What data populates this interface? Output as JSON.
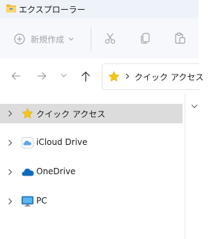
{
  "window": {
    "title": "エクスプローラー",
    "title_icon": "folder-icon"
  },
  "ribbon": {
    "new_label": "新規作成",
    "new_icon": "plus-circle-icon",
    "actions": [
      "cut-icon",
      "copy-icon",
      "paste-icon"
    ]
  },
  "nav": {
    "buttons": [
      "back-arrow-icon",
      "forward-arrow-icon",
      "recent-dropdown-icon",
      "up-arrow-icon"
    ],
    "address": {
      "icon": "star-icon",
      "path": "クイック アクセス"
    }
  },
  "tree": {
    "items": [
      {
        "label": "クイック アクセス",
        "icon": "star-icon",
        "selected": true
      },
      {
        "label": "iCloud Drive",
        "icon": "icloud-icon",
        "selected": false
      },
      {
        "label": "OneDrive",
        "icon": "onedrive-cloud-icon",
        "selected": false
      },
      {
        "label": "PC",
        "icon": "monitor-icon",
        "selected": false
      }
    ]
  },
  "colors": {
    "star": "#f5c518",
    "onedrive": "#0f6cbd",
    "icloud": "#5ea6e8",
    "selection": "#dcdcdc",
    "ribbon_disabled": "#a0a3a8"
  }
}
